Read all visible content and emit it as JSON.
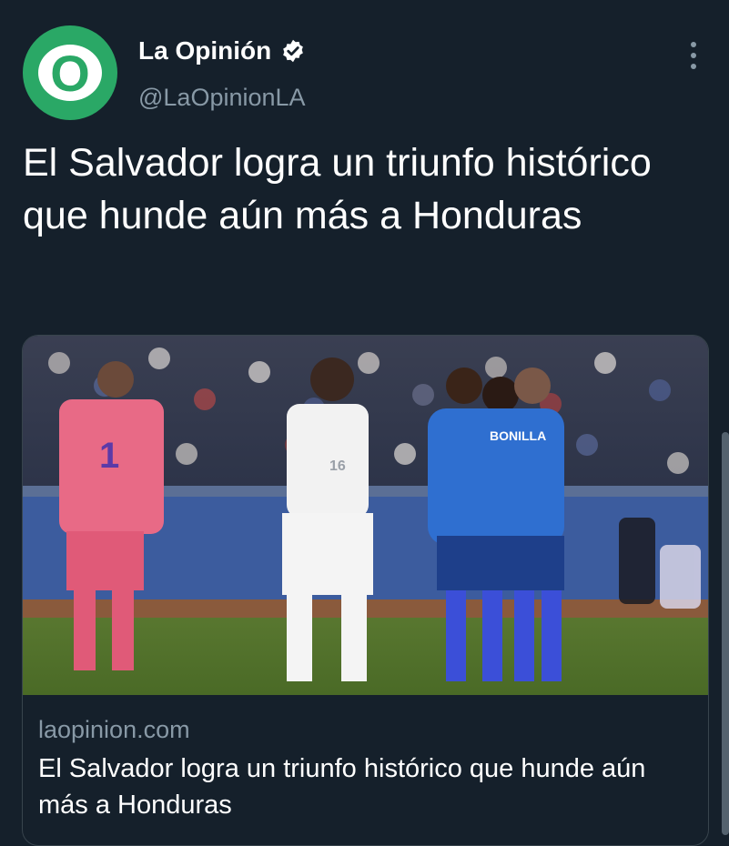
{
  "account": {
    "avatar_letter": "O",
    "display_name": "La Opinión",
    "handle": "@LaOpinionLA",
    "brand_color": "#2aa866"
  },
  "icons": {
    "verified": "verified-badge-icon",
    "more": "more-options-icon"
  },
  "tweet": {
    "text": "El Salvador logra un triunfo histórico que hunde aún más a Honduras"
  },
  "card": {
    "image_alt": "Jugadores de El Salvador celebrando en el campo ante jugadores de Honduras",
    "jersey_name": "BONILLA",
    "jersey_number_left": "1",
    "jersey_number_white": "16",
    "domain": "laopinion.com",
    "title": "El Salvador logra un triunfo histórico que hunde aún más a Honduras"
  },
  "colors": {
    "background": "#15202b",
    "secondary_text": "#8899a6",
    "border": "#38444d"
  }
}
